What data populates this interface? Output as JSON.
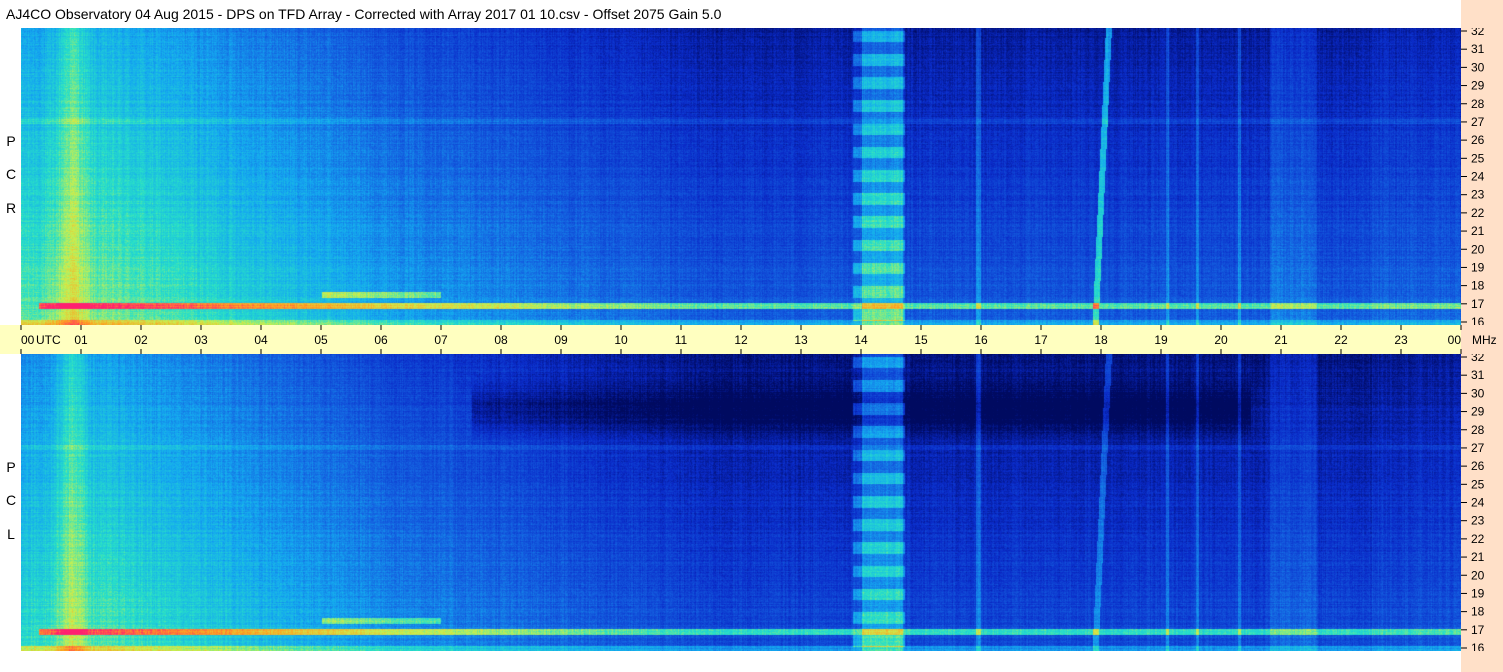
{
  "title": "AJ4CO Observatory  04 Aug 2015  -  DPS on TFD Array  -  Corrected with Array 2017 01 10.csv  -  Offset 2075  Gain 5.0",
  "panels": [
    {
      "polarization": "RCP",
      "label_letters": [
        "P",
        "C",
        "R"
      ]
    },
    {
      "polarization": "LCP",
      "label_letters": [
        "P",
        "C",
        "L"
      ]
    }
  ],
  "chart_data": {
    "type": "heatmap",
    "title": "AJ4CO Observatory  04 Aug 2015  -  DPS on TFD Array  -  Corrected with Array 2017 01 10.csv  -  Offset 2075  Gain 5.0",
    "x_axis": {
      "unit_label": "UTC",
      "tick_labels": [
        "00",
        "01",
        "02",
        "03",
        "04",
        "05",
        "06",
        "07",
        "08",
        "09",
        "10",
        "11",
        "12",
        "13",
        "14",
        "15",
        "16",
        "17",
        "18",
        "19",
        "20",
        "21",
        "22",
        "23",
        "00"
      ],
      "range_hours": [
        0,
        24
      ]
    },
    "y_axis": {
      "unit_label": "MHz",
      "tick_labels": [
        "32",
        "31",
        "30",
        "29",
        "28",
        "27",
        "26",
        "25",
        "24",
        "23",
        "22",
        "21",
        "20",
        "19",
        "18",
        "17",
        "16"
      ],
      "range_mhz": [
        16,
        32
      ]
    },
    "colormap": [
      "#000a60",
      "#0a2ac8",
      "#1460e0",
      "#14a8f0",
      "#28e0c8",
      "#c8f050",
      "#ffa020",
      "#ff2070"
    ],
    "axis_background": "#ffffc0",
    "right_strip_color": "#ffe0c8"
  }
}
